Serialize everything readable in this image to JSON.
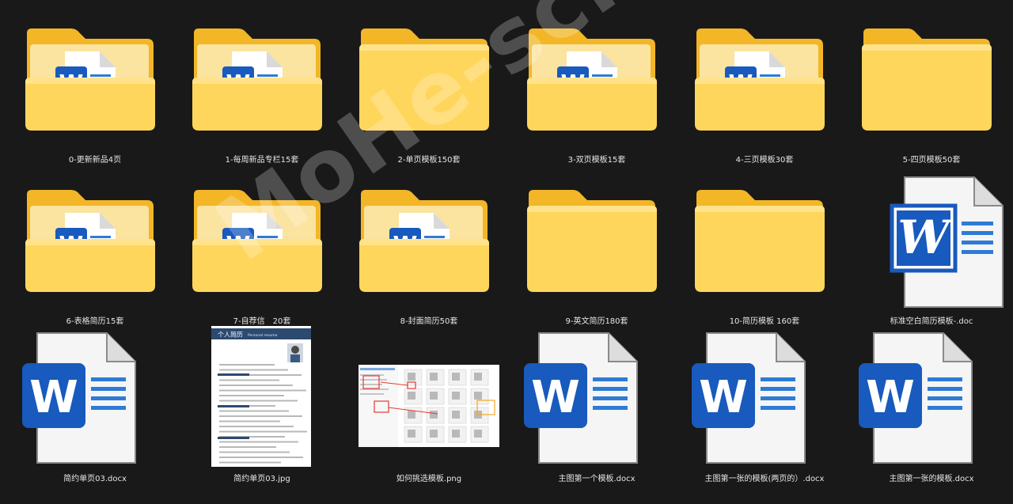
{
  "watermark": "MoHe-sc.com",
  "items": [
    {
      "label": "0-更新新品4页",
      "type": "folder-doc"
    },
    {
      "label": "1-每周新品专栏15套",
      "type": "folder-doc"
    },
    {
      "label": "2-单页模板150套",
      "type": "folder"
    },
    {
      "label": "3-双页模板15套",
      "type": "folder-doc"
    },
    {
      "label": "4-三页模板30套",
      "type": "folder-doc"
    },
    {
      "label": "5-四页模板50套",
      "type": "folder"
    },
    {
      "label": "6-表格简历15套",
      "type": "folder-doc"
    },
    {
      "label": "7-自荐信　20套",
      "type": "folder-doc"
    },
    {
      "label": "8-封面简历50套",
      "type": "folder-doc"
    },
    {
      "label": "9-英文简历180套",
      "type": "folder"
    },
    {
      "label": "10-简历模板 160套",
      "type": "folder"
    },
    {
      "label": "标准空白简历模板-.doc",
      "type": "doc-old"
    },
    {
      "label": "简约单页03.docx",
      "type": "docx"
    },
    {
      "label": "简约单页03.jpg",
      "type": "jpg"
    },
    {
      "label": "如何挑选模板.png",
      "type": "png"
    },
    {
      "label": "主图第一个模板.docx",
      "type": "docx"
    },
    {
      "label": "主图第一张的模板(两页的）.docx",
      "type": "docx"
    },
    {
      "label": "主图第一张的模板.docx",
      "type": "docx"
    }
  ],
  "resume_preview": {
    "title": "个人简历",
    "subtitle": "Personal resume"
  },
  "colors": {
    "background": "#191919",
    "folder_back": "#f2b627",
    "folder_front": "#ffd65c",
    "word_blue": "#185abd"
  }
}
